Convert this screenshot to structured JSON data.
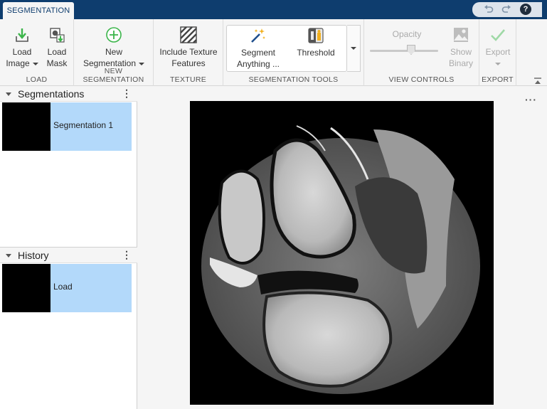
{
  "tab": {
    "label": "SEGMENTATION"
  },
  "quick_access": {
    "undo_icon": "undo-icon",
    "redo_icon": "redo-icon",
    "help_label": "?"
  },
  "toolstrip": {
    "load": {
      "label": "LOAD",
      "load_image": {
        "line1": "Load",
        "line2": "Image"
      },
      "load_mask": {
        "line1": "Load",
        "line2": "Mask"
      }
    },
    "new_segmentation": {
      "label": "NEW SEGMENTATION",
      "button": {
        "line1": "New",
        "line2": "Segmentation"
      }
    },
    "texture": {
      "label": "TEXTURE",
      "button": {
        "line1": "Include Texture",
        "line2": "Features"
      }
    },
    "segmentation_tools": {
      "label": "SEGMENTATION TOOLS",
      "segment_anything": {
        "line1": "Segment",
        "line2": "Anything ..."
      },
      "threshold": {
        "line1": "Threshold"
      }
    },
    "view_controls": {
      "label": "VIEW CONTROLS",
      "opacity_label": "Opacity",
      "opacity_value": 0.6,
      "show_binary": {
        "line1": "Show",
        "line2": "Binary"
      }
    },
    "export": {
      "label": "EXPORT",
      "button": {
        "line1": "Export"
      }
    }
  },
  "segmentations_panel": {
    "title": "Segmentations",
    "items": [
      {
        "label": "Segmentation 1"
      }
    ]
  },
  "history_panel": {
    "title": "History",
    "items": [
      {
        "label": "Load"
      }
    ]
  },
  "colors": {
    "title_bar": "#0e3d6e",
    "selection": "#b3d9fa",
    "accent_green": "#3bb54a"
  }
}
